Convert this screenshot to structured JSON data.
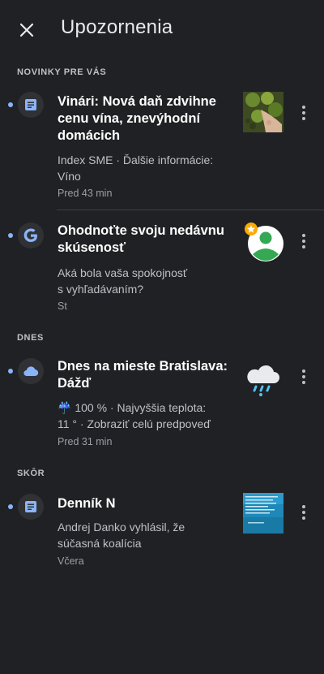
{
  "header": {
    "title": "Upozornenia",
    "close_icon": "close-icon"
  },
  "sections": {
    "news_for_you": "NOVINKY PRE VÁS",
    "today": "DNES",
    "earlier": "SKÔR"
  },
  "items": [
    {
      "app_icon": "article-icon",
      "title_line1": "Vinári: Nová daň zdvihne",
      "title_line2": "cenu vína, znevýhodní",
      "title_line3": "domácich",
      "sub_line1": "Index SME · Ďalšie informácie:",
      "sub_line2": "Víno",
      "time": "Pred 43 min",
      "thumb": "vineyard-photo"
    },
    {
      "app_icon": "google-icon",
      "title_line1": "Ohodnoťte svoju nedávnu",
      "title_line2": "skúsenosť",
      "sub_line1": "Aká bola vaša spokojnosť",
      "sub_line2": "s vyhľadávaním?",
      "time": "St",
      "thumb": "avatar-star"
    },
    {
      "app_icon": "cloud-icon",
      "title_line1": "Dnes na mieste Bratislava:",
      "title_line2": "Dážď",
      "sub_line1": "☔ 100 % · Najvyššia teplota:",
      "sub_line2": "11 ° · Zobraziť celú predpoveď",
      "time": "Pred 31 min",
      "thumb": "rain-cloud-icon"
    },
    {
      "app_icon": "article-icon",
      "title_line1": "Denník N",
      "sub_line1": "Andrej Danko vyhlásil, že",
      "sub_line2": "súčasná koalícia",
      "time": "Včera",
      "thumb": "news-image"
    }
  ],
  "colors": {
    "background": "#202124",
    "accent": "#8ab4f8",
    "text": "#e8eaed",
    "secondary": "#bdc1c6"
  }
}
